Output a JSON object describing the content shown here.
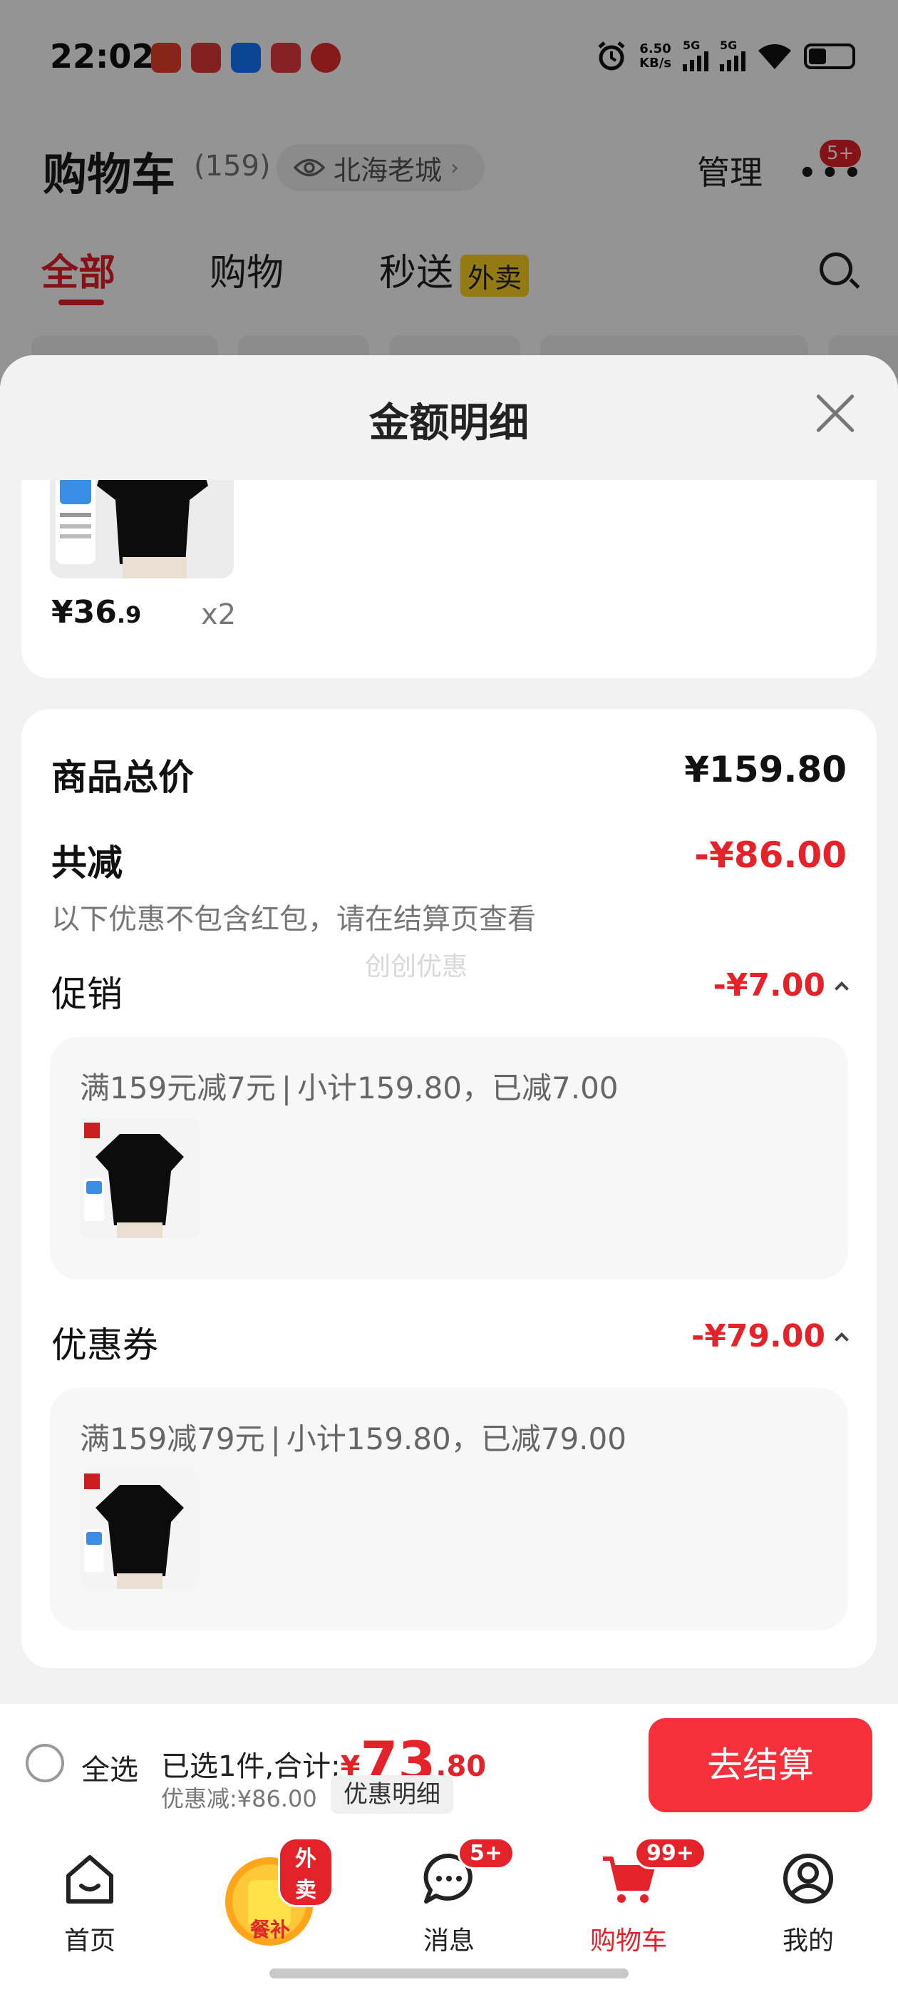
{
  "status_bar": {
    "time": "22:02",
    "net_speed_value": "6.50",
    "net_speed_unit": "KB/s",
    "sim1": "5G",
    "sim2": "5G",
    "app_icons": [
      "慢",
      "蛋",
      "支",
      "盒",
      "618"
    ]
  },
  "header": {
    "title": "购物车",
    "count": "(159)",
    "location": "北海老城",
    "manage": "管理",
    "more_badge": "5+"
  },
  "tabs": [
    {
      "label": "全部",
      "active": true
    },
    {
      "label": "购物",
      "active": false
    },
    {
      "label": "秒送",
      "tag": "外卖",
      "active": false
    }
  ],
  "sheet": {
    "title": "金额明细",
    "item": {
      "price_int": "¥36",
      "price_dec": ".9",
      "qty": "x2"
    },
    "total_label": "商品总价",
    "total_value": "¥159.80",
    "reduce_label": "共减",
    "reduce_value": "-¥86.00",
    "reduce_note": "以下优惠不包含红包，请在结算页查看",
    "watermark": "创创优惠",
    "promo": {
      "label": "促销",
      "value": "-¥7.00",
      "rule": "满159元减7元",
      "sep": "|",
      "subtotal": "小计159.80，已减7.00"
    },
    "coupon": {
      "label": "优惠券",
      "value": "-¥79.00",
      "rule": "满159减79元",
      "sep": "|",
      "subtotal": "小计159.80，已减79.00"
    }
  },
  "checkout": {
    "select_all": "全选",
    "selected_prefix": "已选1件,合计:",
    "currency": "¥",
    "amount_int": "73",
    "amount_dec": ".80",
    "discount": "优惠减:¥86.00",
    "detail_button": "优惠明细",
    "checkout_button": "去结算"
  },
  "nav": [
    {
      "label": "首页",
      "icon": "home-icon"
    },
    {
      "label": "",
      "icon": "meal-subsidy-icon",
      "badge": "外卖",
      "inner": "餐补"
    },
    {
      "label": "消息",
      "icon": "message-icon",
      "badge": "5+"
    },
    {
      "label": "购物车",
      "icon": "cart-icon",
      "badge": "99+",
      "active": true
    },
    {
      "label": "我的",
      "icon": "profile-icon"
    }
  ],
  "colors": {
    "accent_red": "#e4222a",
    "checkout_button": "#f5303a",
    "tag_yellow": "#ffd21f"
  }
}
